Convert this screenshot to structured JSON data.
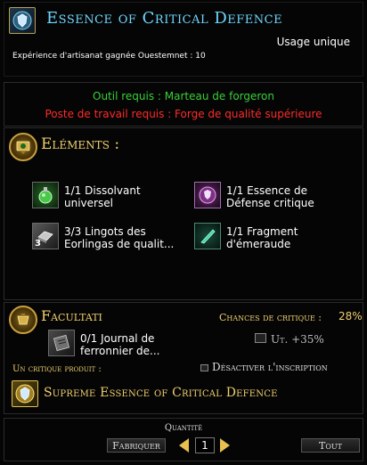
{
  "header": {
    "title": "Essence of Critical Defence",
    "usage": "Usage unique",
    "xp_text": "Expérience d'artisanat gagnée Ouestemnet : 10"
  },
  "requirements": {
    "tool": "Outil requis : Marteau de forgeron",
    "station": "Poste de travail requis : Forge de qualité supérieure",
    "tool_color": "#39d038",
    "station_color": "#ff2a2a"
  },
  "elements": {
    "heading": "Eléments :",
    "items": [
      {
        "line1": "1/1 Dissolvant",
        "line2": "universel",
        "icon": "flask-icon"
      },
      {
        "line1": "1/1 Essence de",
        "line2": "Défense critique",
        "icon": "shield-essence-icon"
      },
      {
        "line1": "3/3 Lingots des",
        "line2": "Eorlingas de qualit...",
        "icon": "ingot-icon",
        "count": "3"
      },
      {
        "line1": "1/1 Fragment",
        "line2": "d'émeraude",
        "icon": "emerald-shard-icon"
      }
    ]
  },
  "optional": {
    "heading": "Facultati",
    "crit_label": "Chances de critique :",
    "crit_value": "28%",
    "journal_line1": "0/1 Journal de",
    "journal_line2": "ferronnier de...",
    "use_label": "Ut. +35%",
    "critical_product_label": "Un critique produit :",
    "disable_label": "Désactiver l'inscription",
    "critical_product": "Supreme Essence of Critical Defence"
  },
  "footer": {
    "quantity_label": "Quantité",
    "make_button": "Fabriquer",
    "quantity_value": "1",
    "all_button": "Tout"
  }
}
